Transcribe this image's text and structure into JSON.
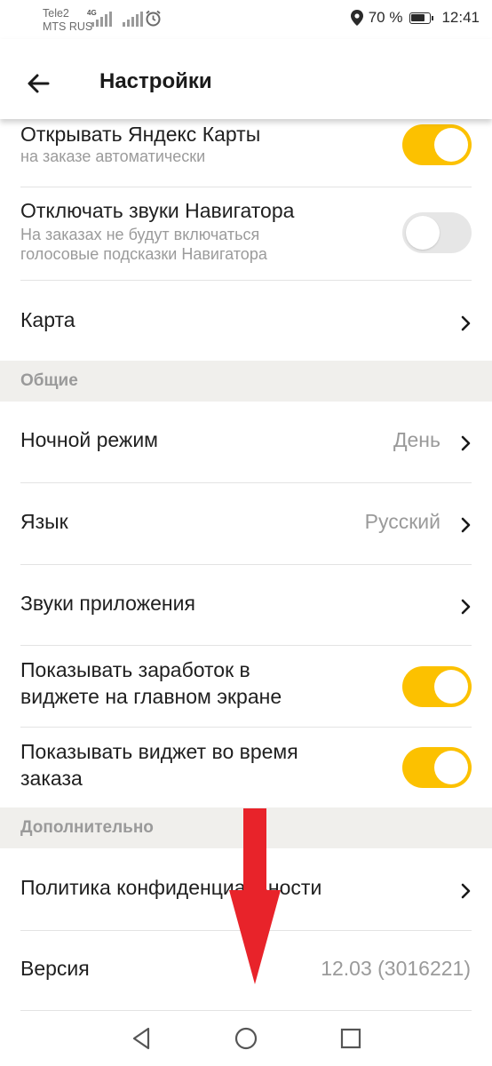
{
  "status_bar": {
    "carrier_1": "Tele2",
    "carrier_2": "MTS RUS",
    "network_type": "4G",
    "battery_percent": "70 %",
    "time": "12:41",
    "icons": [
      "signal-icon",
      "alarm-icon",
      "location-icon",
      "battery-icon"
    ]
  },
  "header": {
    "title": "Настройки",
    "back_icon": "arrow-left-icon"
  },
  "settings": {
    "open_maps": {
      "title": "Открывать Яндекс Карты",
      "subtitle": "на заказе автоматически",
      "enabled": true
    },
    "mute_navigator": {
      "title": "Отключать звуки Навигатора",
      "subtitle_line1": "На заказах не будут включаться",
      "subtitle_line2": "голосовые подсказки Навигатора",
      "enabled": false
    },
    "map": {
      "title": "Карта"
    },
    "section_general": "Общие",
    "night_mode": {
      "title": "Ночной режим",
      "value": "День"
    },
    "language": {
      "title": "Язык",
      "value": "Русский"
    },
    "app_sounds": {
      "title": "Звуки приложения"
    },
    "show_earnings": {
      "title_line1": "Показывать заработок в",
      "title_line2": "виджете на главном экране",
      "enabled": true
    },
    "show_widget": {
      "title_line1": "Показывать виджет во время",
      "title_line2": "заказа",
      "enabled": true
    },
    "section_additional": "Дополнительно",
    "privacy_policy": {
      "title": "Политика конфиденциальности"
    },
    "version": {
      "title": "Версия",
      "value": "12.03 (3016221)"
    }
  },
  "nav_bar": {
    "icons": [
      "back-triangle-icon",
      "home-circle-icon",
      "recents-square-icon"
    ]
  },
  "colors": {
    "accent_toggle_on": "#fcc100",
    "toggle_off": "#e6e6e6",
    "section_bg": "#f0efec",
    "annotation_arrow": "#e8232a"
  }
}
